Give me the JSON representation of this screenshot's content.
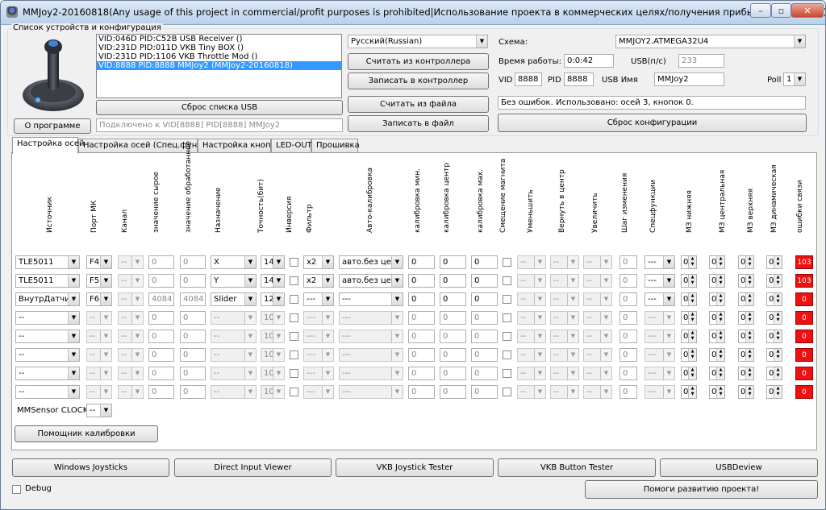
{
  "window": {
    "title": "MMJoy2-20160818(Any usage of this project in commercial/profit purposes is prohibited|Использование проекта в коммерческих целях/получения прибыли запрещено)",
    "min": "–",
    "max": "▫",
    "close": "✕"
  },
  "devices": {
    "group_label": "Список устройств и конфигурация",
    "list": [
      "VID:046D PID:C52B USB Receiver ()",
      "VID:231D PID:011D VKB Tiny BOX  ()",
      "VID:231D PID:1106 VKB Throttle Mod ()",
      "VID:8888 PID:8888 MMJoy2 (MMJoy2-20160818)"
    ],
    "selected_index": 3,
    "reset_list_button": "Сброс списка USB",
    "about_button": "О программе",
    "status": "Подключено к VID[8888] PID[8888] MMJoy2"
  },
  "actions": {
    "language": "Русский(Russian)",
    "read_controller": "Считать из контроллера",
    "write_controller": "Записать в контроллер",
    "read_file": "Считать из файла",
    "write_file": "Записать в файл"
  },
  "config": {
    "scheme_label": "Схема:",
    "scheme_value": "MMJOY2.ATMEGA32U4",
    "uptime_label": "Время работы:",
    "uptime_value": "0:0:42",
    "usb_label": "USB(п/с)",
    "usb_value": "233",
    "vid_label": "VID",
    "vid_value": "8888",
    "pid_label": "PID",
    "pid_value": "8888",
    "usb_name_label": "USB Имя",
    "usb_name_value": "MMJoy2",
    "poll_label": "Poll",
    "poll_value": "1",
    "message": "Без ошибок. Использовано: осей  3, кнопок  0.",
    "reset_config_button": "Сброс конфигурации"
  },
  "tabs": [
    {
      "label": "Настройка осей",
      "active": true
    },
    {
      "label": "Настройка осей (Спец.функции)",
      "active": false
    },
    {
      "label": "Настройка кнопок",
      "active": false
    },
    {
      "label": "LED-OUT",
      "active": false
    },
    {
      "label": "Прошивка",
      "active": false
    }
  ],
  "axes": {
    "headers": [
      "Источник",
      "Порт МК",
      "Канал",
      "значение сырое",
      "значение обработанное",
      "Назначение",
      "Точность(бит)",
      "Инверсия",
      "Фильтр",
      "Авто-калибровка",
      "калибровка мин.",
      "калибровка центр",
      "калибровка мах.",
      "Смещение магнита",
      "Уменьшить",
      "Вернуть в центр",
      "Увеличить",
      "Шаг изменения",
      "Спецфункции",
      "МЗ нижняя",
      "МЗ центральная",
      "МЗ верхняя",
      "МЗ динамическая",
      "ошибки связи"
    ],
    "rows": [
      {
        "source": "TLE5011",
        "port": "F4",
        "channel": "--",
        "raw": "0",
        "proc": "0",
        "target": "X",
        "bits": "14",
        "filter": "x2",
        "autocal": "авто.без центр",
        "cmin": "0",
        "ccen": "0",
        "cmax": "0",
        "reduce": "--",
        "center": "--",
        "increase": "--",
        "step": "0",
        "spec": "---",
        "dz_low": "0",
        "dz_cen": "0",
        "dz_up": "0",
        "dz_dyn": "0",
        "err": "103",
        "enabled": true
      },
      {
        "source": "TLE5011",
        "port": "F5",
        "channel": "--",
        "raw": "0",
        "proc": "0",
        "target": "Y",
        "bits": "14",
        "filter": "x2",
        "autocal": "авто.без центр",
        "cmin": "0",
        "ccen": "0",
        "cmax": "0",
        "reduce": "--",
        "center": "--",
        "increase": "--",
        "step": "0",
        "spec": "---",
        "dz_low": "0",
        "dz_cen": "0",
        "dz_up": "0",
        "dz_dyn": "0",
        "err": "103",
        "enabled": true
      },
      {
        "source": "ВнутрДатчик",
        "port": "F6",
        "channel": "--",
        "raw": "4084",
        "proc": "4084",
        "target": "Slider",
        "bits": "12",
        "filter": "---",
        "autocal": "---",
        "cmin": "0",
        "ccen": "0",
        "cmax": "0",
        "reduce": "--",
        "center": "--",
        "increase": "--",
        "step": "0",
        "spec": "---",
        "dz_low": "0",
        "dz_cen": "0",
        "dz_up": "0",
        "dz_dyn": "0",
        "err": "0",
        "enabled": true
      },
      {
        "source": "--",
        "port": "--",
        "channel": "--",
        "raw": "0",
        "proc": "0",
        "target": "--",
        "bits": "10",
        "filter": "---",
        "autocal": "---",
        "cmin": "0",
        "ccen": "0",
        "cmax": "0",
        "reduce": "--",
        "center": "--",
        "increase": "--",
        "step": "0",
        "spec": "---",
        "dz_low": "0",
        "dz_cen": "0",
        "dz_up": "0",
        "dz_dyn": "0",
        "err": "0",
        "enabled": false
      },
      {
        "source": "--",
        "port": "--",
        "channel": "--",
        "raw": "0",
        "proc": "0",
        "target": "--",
        "bits": "10",
        "filter": "---",
        "autocal": "---",
        "cmin": "0",
        "ccen": "0",
        "cmax": "0",
        "reduce": "--",
        "center": "--",
        "increase": "--",
        "step": "0",
        "spec": "---",
        "dz_low": "0",
        "dz_cen": "0",
        "dz_up": "0",
        "dz_dyn": "0",
        "err": "0",
        "enabled": false
      },
      {
        "source": "--",
        "port": "--",
        "channel": "--",
        "raw": "0",
        "proc": "0",
        "target": "--",
        "bits": "10",
        "filter": "---",
        "autocal": "---",
        "cmin": "0",
        "ccen": "0",
        "cmax": "0",
        "reduce": "--",
        "center": "--",
        "increase": "--",
        "step": "0",
        "spec": "---",
        "dz_low": "0",
        "dz_cen": "0",
        "dz_up": "0",
        "dz_dyn": "0",
        "err": "0",
        "enabled": false
      },
      {
        "source": "--",
        "port": "--",
        "channel": "--",
        "raw": "0",
        "proc": "0",
        "target": "--",
        "bits": "10",
        "filter": "---",
        "autocal": "---",
        "cmin": "0",
        "ccen": "0",
        "cmax": "0",
        "reduce": "--",
        "center": "--",
        "increase": "--",
        "step": "0",
        "spec": "---",
        "dz_low": "0",
        "dz_cen": "0",
        "dz_up": "0",
        "dz_dyn": "0",
        "err": "0",
        "enabled": false
      },
      {
        "source": "--",
        "port": "--",
        "channel": "--",
        "raw": "0",
        "proc": "0",
        "target": "--",
        "bits": "10",
        "filter": "---",
        "autocal": "---",
        "cmin": "0",
        "ccen": "0",
        "cmax": "0",
        "reduce": "--",
        "center": "--",
        "increase": "--",
        "step": "0",
        "spec": "---",
        "dz_low": "0",
        "dz_cen": "0",
        "dz_up": "0",
        "dz_dyn": "0",
        "err": "0",
        "enabled": false
      }
    ],
    "mmsensor_label": "MMSensor CLOCK",
    "mmsensor_value": "--",
    "calibration_helper": "Помощник калибровки"
  },
  "bottom": {
    "buttons": [
      "Windows Joysticks",
      "Direct Input Viewer",
      "VKB Joystick Tester",
      "VKB Button Tester",
      "USBDeview"
    ],
    "debug_label": "Debug",
    "support_button": "Помоги развитию проекта!"
  },
  "colors": {
    "error_red": "#ee1111",
    "selection_blue": "#3399ff"
  }
}
